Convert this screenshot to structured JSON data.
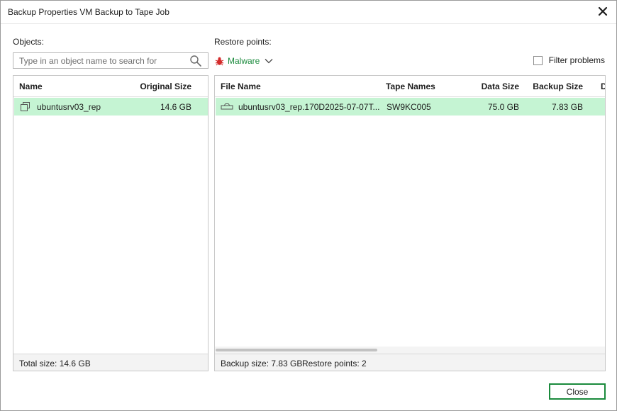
{
  "window": {
    "title": "Backup Properties VM Backup to Tape Job"
  },
  "objects": {
    "label": "Objects:",
    "search_placeholder": "Type in an object name to search for",
    "columns": {
      "name": "Name",
      "original_size": "Original Size"
    },
    "rows": [
      {
        "name": "ubuntusrv03_rep",
        "original_size": "14.6 GB"
      }
    ],
    "footer": "Total size: 14.6 GB"
  },
  "restore_points": {
    "label": "Restore points:",
    "malware_label": "Malware",
    "filter_label": "Filter problems",
    "columns": {
      "file_name": "File Name",
      "tape_names": "Tape Names",
      "data_size": "Data Size",
      "backup_size": "Backup Size",
      "extra": "D"
    },
    "rows": [
      {
        "file_name": "ubuntusrv03_rep.170D2025-07-07T...",
        "tape_names": "SW9KC005",
        "data_size": "75.0 GB",
        "backup_size": "7.83 GB"
      }
    ],
    "footer": {
      "backup_size": "Backup size: 7.83 GB",
      "restore_points": "Restore points: 2"
    }
  },
  "buttons": {
    "close": "Close"
  },
  "colors": {
    "selection": "#c5f4d3",
    "accent_green": "#1a8a3c",
    "malware_red": "#d42b2b"
  }
}
